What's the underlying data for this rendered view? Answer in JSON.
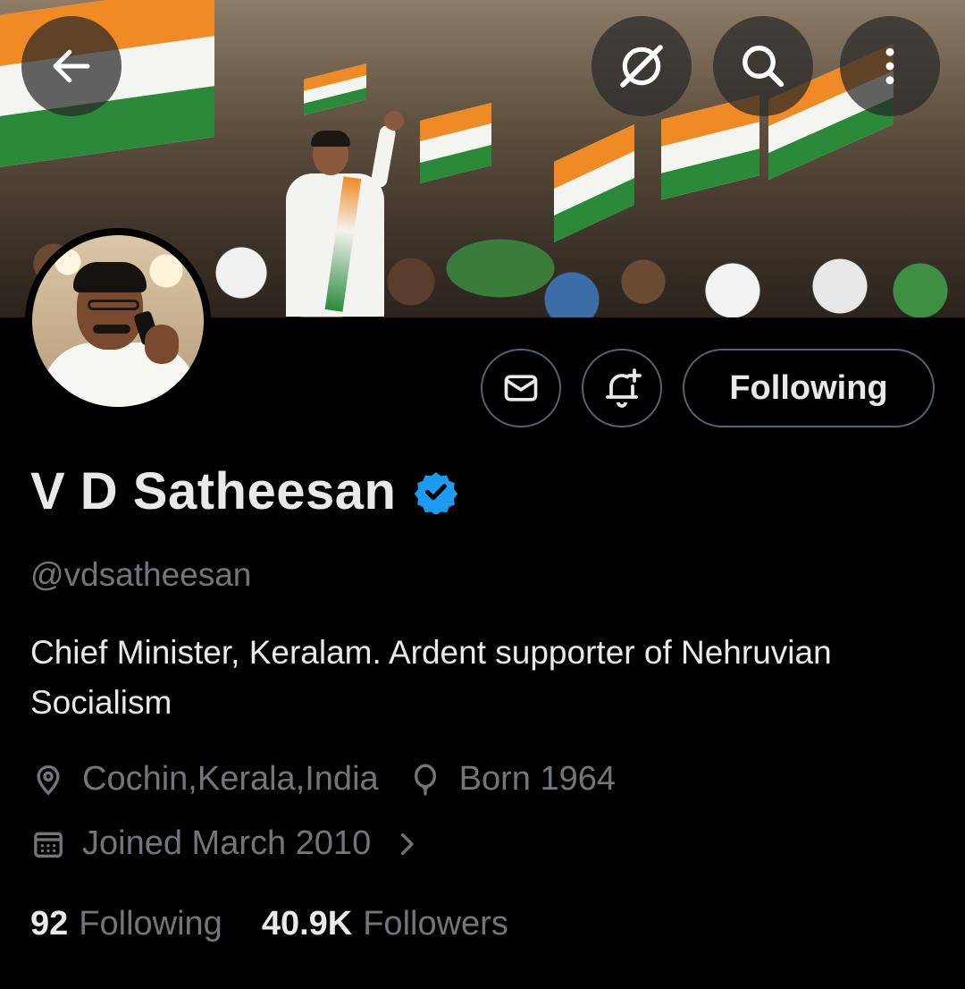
{
  "header": {
    "back_icon": "arrow-left-icon",
    "grok_icon": "grok-icon",
    "search_icon": "search-icon",
    "more_icon": "more-vertical-icon"
  },
  "actions": {
    "message_icon": "mail-icon",
    "notify_icon": "bell-plus-icon",
    "following_label": "Following"
  },
  "profile": {
    "name": "V D Satheesan",
    "verified": true,
    "handle": "@vdsatheesan",
    "bio": "Chief Minister, Keralam. Ardent supporter of Nehruvian Socialism",
    "location": "Cochin,Kerala,India",
    "birth": "Born 1964",
    "joined": "Joined March 2010"
  },
  "stats": {
    "following_count": "92",
    "following_label": "Following",
    "followers_count": "40.9K",
    "followers_label": "Followers"
  },
  "colors": {
    "background": "#000000",
    "text_primary": "#e7e9ea",
    "text_secondary": "#71767b",
    "border": "#536471",
    "verified_blue": "#1d9bf0"
  }
}
